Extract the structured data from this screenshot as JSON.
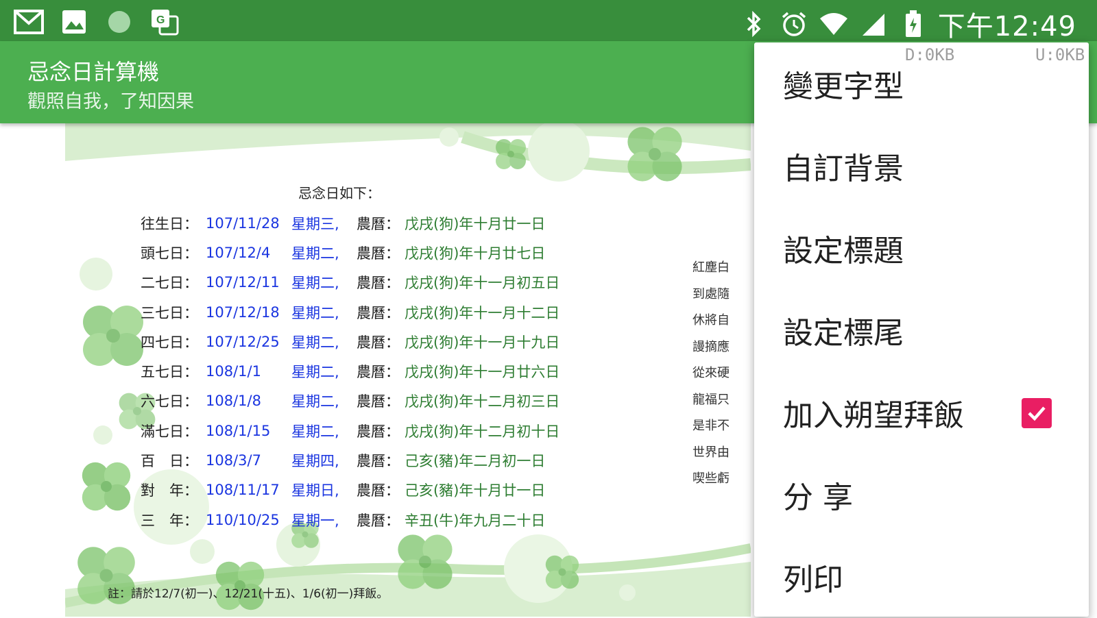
{
  "status_bar": {
    "time": "下午12:49",
    "left_icons": [
      "gmail-icon",
      "image-icon",
      "circle-icon",
      "translate-icon"
    ],
    "right_icons": [
      "bluetooth-icon",
      "alarm-icon",
      "wifi-icon",
      "signal-icon",
      "battery-icon"
    ]
  },
  "app_bar": {
    "title": "忌念日計算機",
    "subtitle": "觀照自我，了知因果"
  },
  "network": {
    "down": "D:0KB",
    "up": "U:0KB"
  },
  "document": {
    "heading": "忌念日如下：",
    "rows": [
      {
        "label": "往生日：",
        "date": "107/11/28",
        "weekday": "星期三,",
        "lunar_label": "農曆：",
        "lunar": "戊戌(狗)年十月廿一日"
      },
      {
        "label": "頭七日：",
        "date": "107/12/4",
        "weekday": "星期二,",
        "lunar_label": "農曆：",
        "lunar": "戊戌(狗)年十月廿七日"
      },
      {
        "label": "二七日：",
        "date": "107/12/11",
        "weekday": "星期二,",
        "lunar_label": "農曆：",
        "lunar": "戊戌(狗)年十一月初五日"
      },
      {
        "label": "三七日：",
        "date": "107/12/18",
        "weekday": "星期二,",
        "lunar_label": "農曆：",
        "lunar": "戊戌(狗)年十一月十二日"
      },
      {
        "label": "四七日：",
        "date": "107/12/25",
        "weekday": "星期二,",
        "lunar_label": "農曆：",
        "lunar": "戊戌(狗)年十一月十九日"
      },
      {
        "label": "五七日：",
        "date": "108/1/1",
        "weekday": "星期二,",
        "lunar_label": "農曆：",
        "lunar": "戊戌(狗)年十一月廿六日"
      },
      {
        "label": "六七日：",
        "date": "108/1/8",
        "weekday": "星期二,",
        "lunar_label": "農曆：",
        "lunar": "戊戌(狗)年十二月初三日"
      },
      {
        "label": "滿七日：",
        "date": "108/1/15",
        "weekday": "星期二,",
        "lunar_label": "農曆：",
        "lunar": "戊戌(狗)年十二月初十日"
      },
      {
        "label": "百　日：",
        "date": "108/3/7",
        "weekday": "星期四,",
        "lunar_label": "農曆：",
        "lunar": "己亥(豬)年二月初一日"
      },
      {
        "label": "對　年：",
        "date": "108/11/17",
        "weekday": "星期日,",
        "lunar_label": "農曆：",
        "lunar": "己亥(豬)年十月廿一日"
      },
      {
        "label": "三　年：",
        "date": "110/10/25",
        "weekday": "星期一,",
        "lunar_label": "農曆：",
        "lunar": "辛丑(牛)年九月二十日"
      }
    ],
    "side_lines": [
      "紅塵白",
      "到處隨",
      "休將自",
      "謾摘應",
      "從來硬",
      "龍福只",
      "是非不",
      "世界由",
      "喫些虧"
    ],
    "note": "註：請於12/7(初一)、12/21(十五)、1/6(初一)拜飯。"
  },
  "menu": {
    "items": [
      {
        "label": "變更字型"
      },
      {
        "label": "自訂背景"
      },
      {
        "label": "設定標題"
      },
      {
        "label": "設定標尾"
      },
      {
        "label": "加入朔望拜飯",
        "checked": true
      },
      {
        "label": "分 享"
      },
      {
        "label": "列印"
      }
    ]
  },
  "colors": {
    "status_bar": "#388e3c",
    "app_bar": "#4caf50",
    "checkbox": "#e91e63",
    "date_text": "#1a35e0",
    "lunar_text": "#2e7d32"
  }
}
